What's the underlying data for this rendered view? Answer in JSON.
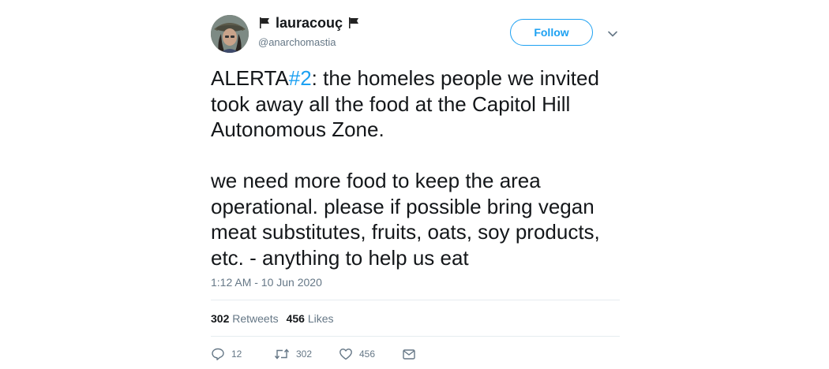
{
  "user": {
    "display_name": "lauracouç",
    "handle": "@anarchomastia"
  },
  "follow_label": "Follow",
  "tweet": {
    "prefix": "ALERTA",
    "hashtag": "#2",
    "line1_rest": ": the homeles people we invited took away all the food at the Capitol Hill Autonomous Zone.",
    "paragraph2": "we need more food to keep the area operational. please if possible bring vegan meat substitutes, fruits, oats, soy products, etc. - anything to help us eat"
  },
  "timestamp": "1:12 AM - 10 Jun 2020",
  "stats": {
    "retweets_count": "302",
    "retweets_label": "Retweets",
    "likes_count": "456",
    "likes_label": "Likes"
  },
  "actions": {
    "reply_count": "12",
    "retweet_count": "302",
    "like_count": "456"
  },
  "colors": {
    "accent": "#1da1f2",
    "secondary_text": "#657786",
    "divider": "#e6ecf0"
  },
  "icons": [
    "flag-icon",
    "chevron-down-icon",
    "reply-icon",
    "retweet-icon",
    "heart-icon",
    "envelope-icon"
  ]
}
